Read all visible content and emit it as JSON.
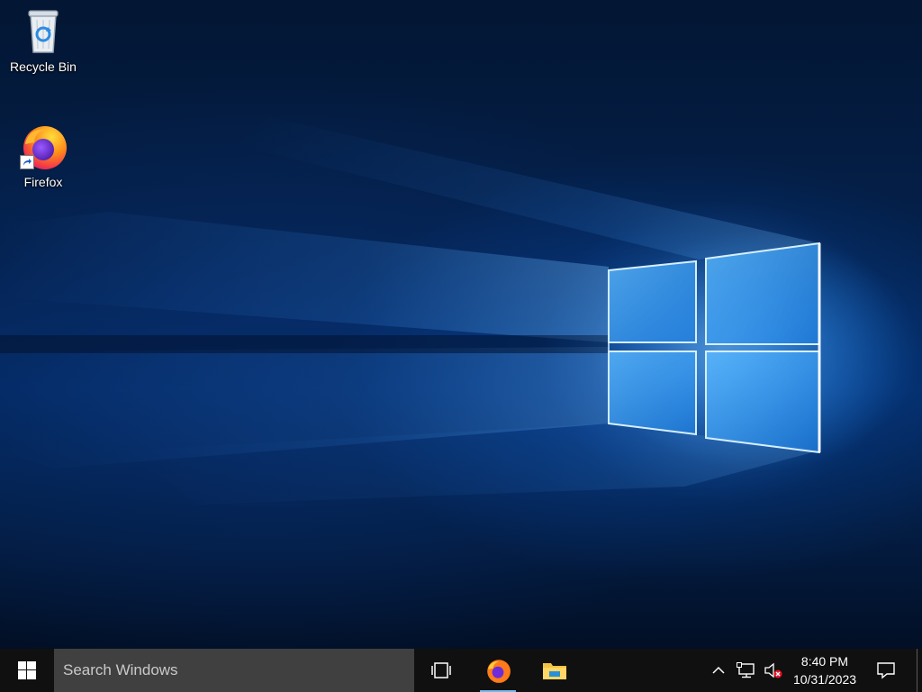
{
  "desktop": {
    "icons": [
      {
        "label": "Recycle Bin",
        "icon": "recycle-bin-icon"
      },
      {
        "label": "Firefox",
        "icon": "firefox-icon",
        "shortcut": true
      }
    ],
    "wallpaper_accent": "#3aa3ff"
  },
  "taskbar": {
    "background": "#101010",
    "start_icon": "windows-logo-icon",
    "search_placeholder": "Search Windows",
    "pinned": [
      {
        "icon": "task-view-icon"
      },
      {
        "icon": "firefox-icon"
      },
      {
        "icon": "file-explorer-icon"
      }
    ],
    "tray": {
      "icons": [
        "chevron-up-icon",
        "network-icon",
        "volume-muted-icon"
      ],
      "time": "8:40 PM",
      "date": "10/31/2023",
      "notifications_icon": "action-center-icon"
    }
  }
}
